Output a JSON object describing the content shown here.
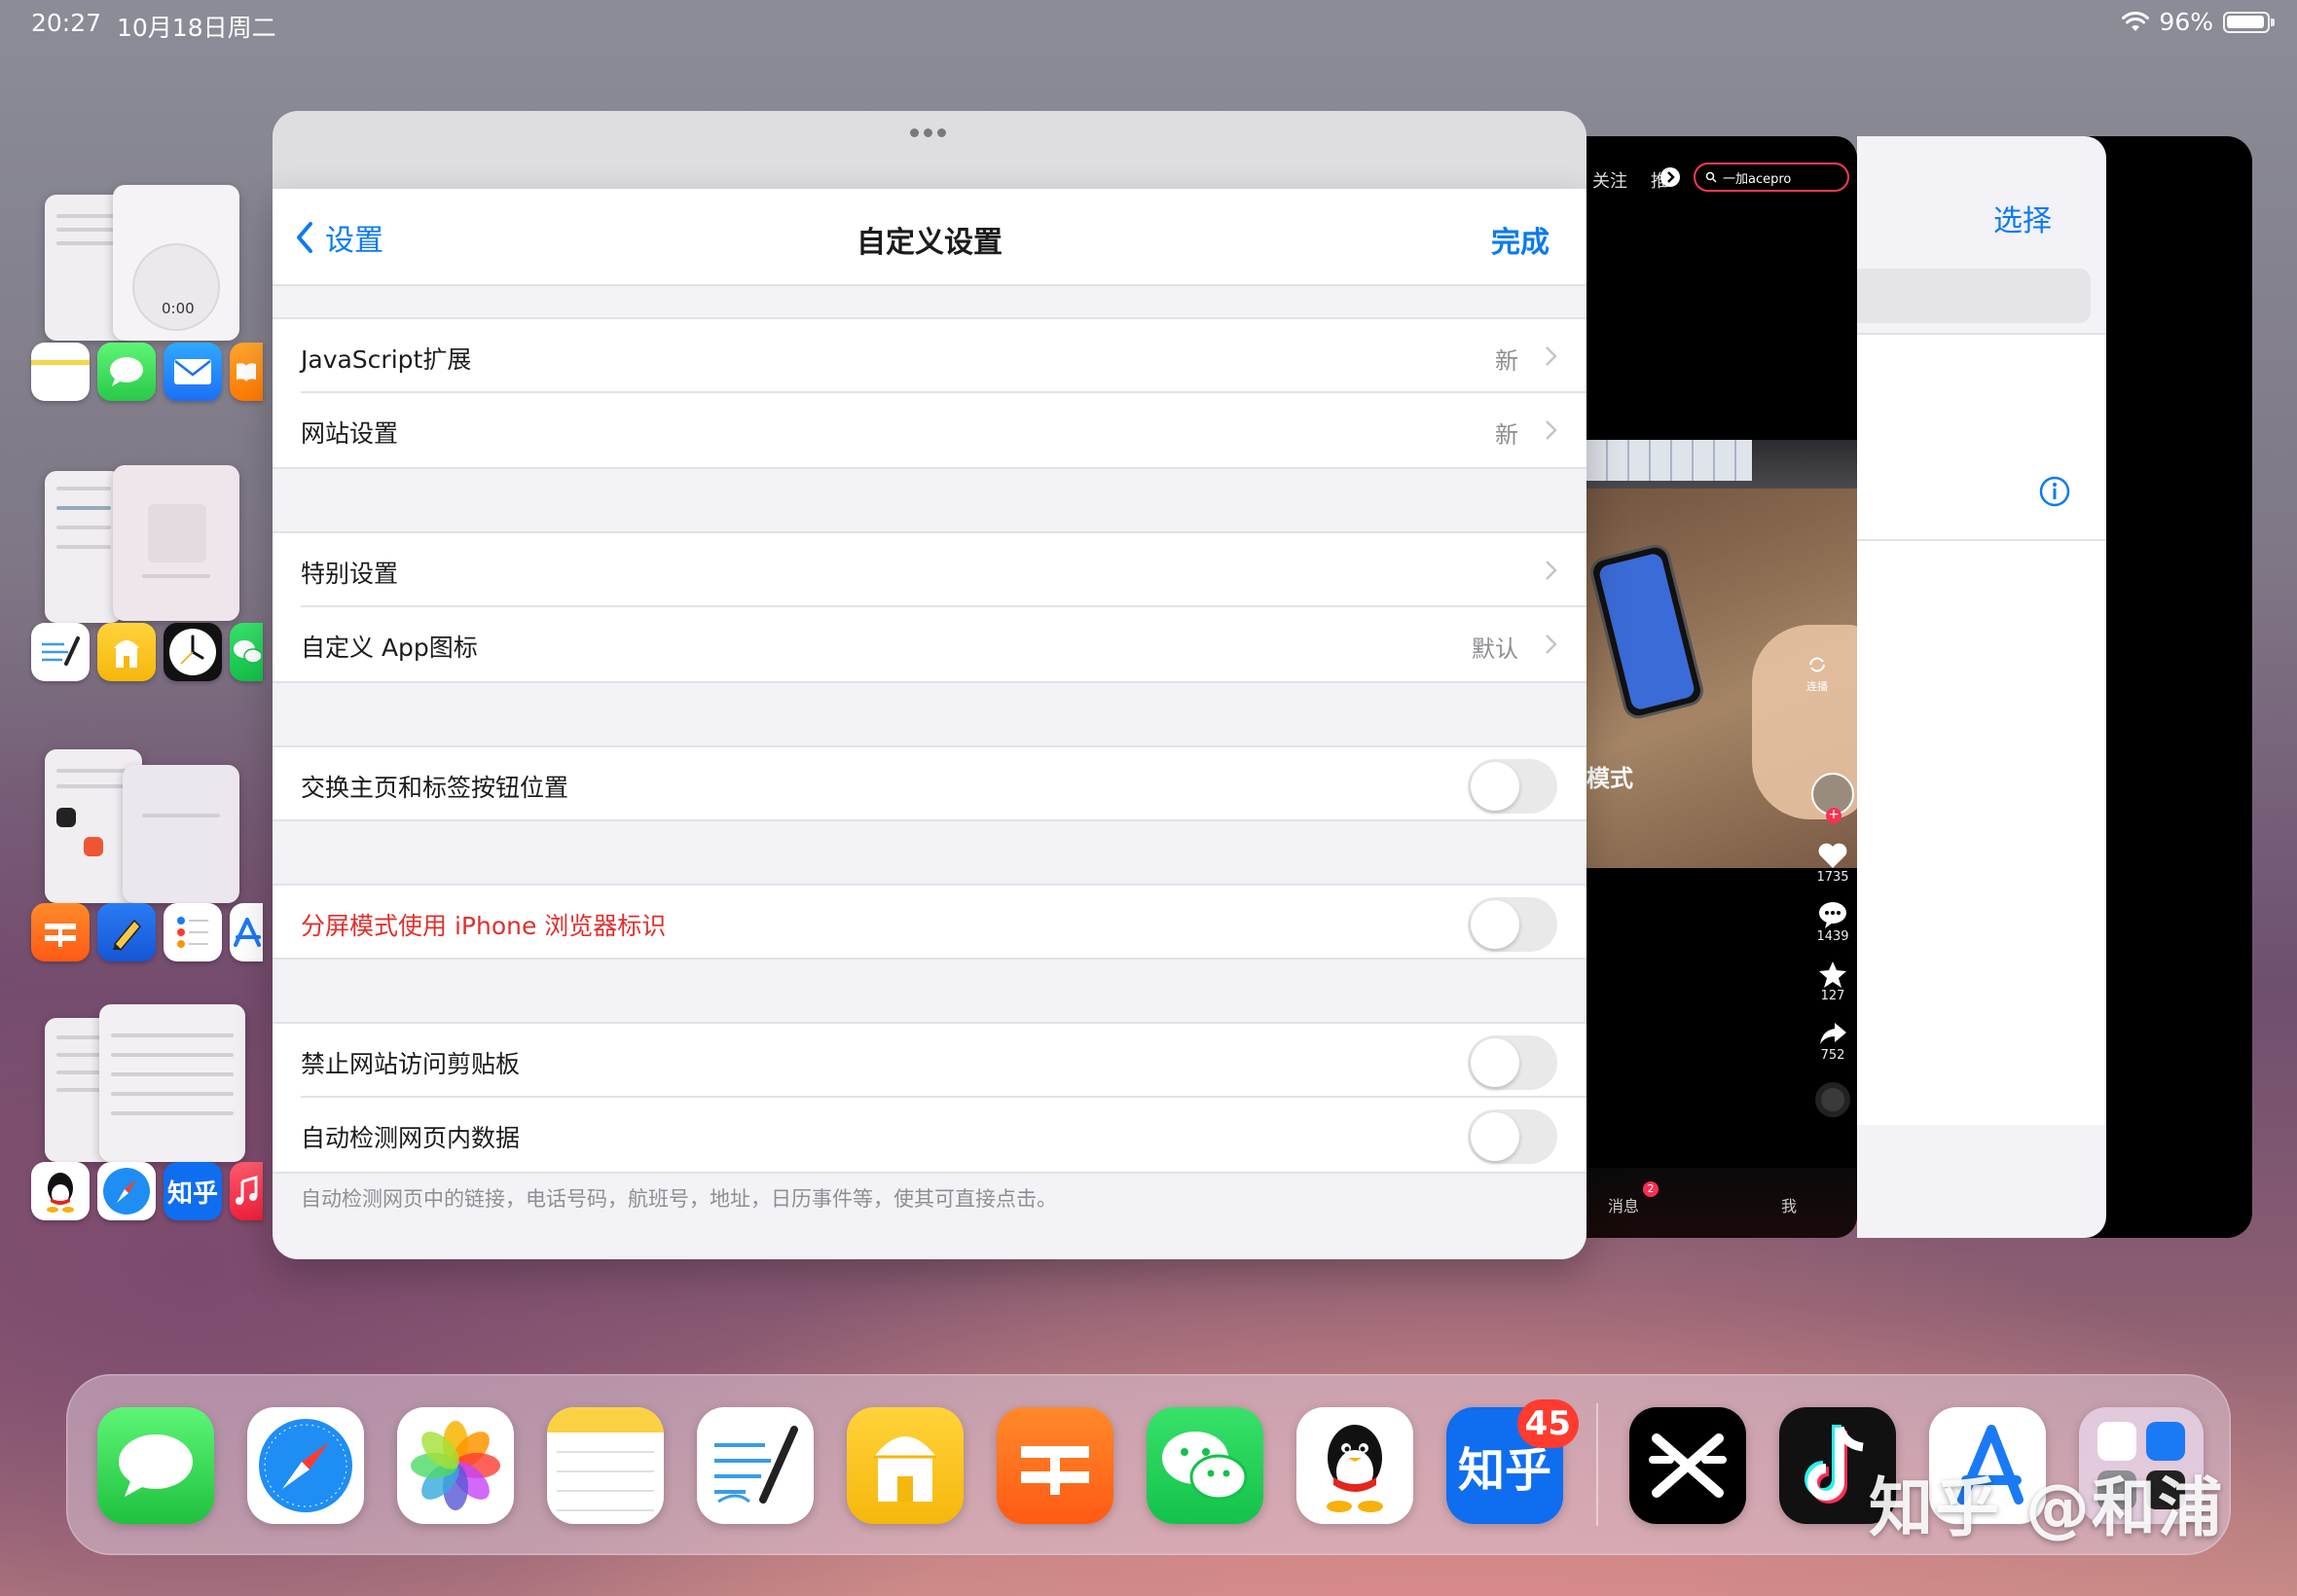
{
  "status_bar": {
    "time": "20:27",
    "date": "10月18日周二",
    "battery": "96%"
  },
  "left_groups": [
    {
      "thumb_label": "0:00",
      "icons": [
        "notes",
        "messages",
        "mail",
        "books"
      ]
    },
    {
      "icons": [
        "freeform",
        "memo",
        "clock",
        "wechat"
      ]
    },
    {
      "icons": [
        "pages",
        "pencil",
        "reminders",
        "appstore"
      ]
    },
    {
      "icons": [
        "qq",
        "safari",
        "zhihu",
        "music"
      ],
      "zhihu_label": "知乎"
    }
  ],
  "settings": {
    "back_label": "设置",
    "title": "自定义设置",
    "done_label": "完成",
    "rows": {
      "js": {
        "label": "JavaScript扩展",
        "value": "新"
      },
      "site": {
        "label": "网站设置",
        "value": "新"
      },
      "special": {
        "label": "特别设置"
      },
      "app_icon": {
        "label": "自定义 App图标",
        "value": "默认"
      },
      "swap": {
        "label": "交换主页和标签按钮位置",
        "on": false
      },
      "split": {
        "label": "分屏模式使用 iPhone 浏览器标识",
        "on": false
      },
      "clipboard": {
        "label": "禁止网站访问剪贴板",
        "on": false
      },
      "detect": {
        "label": "自动检测网页内数据",
        "on": false
      }
    },
    "footer": "自动检测网页中的链接，电话号码，航班号，地址，日历事件等，使其可直接点击。"
  },
  "douyin": {
    "tab_follow": "关注",
    "tab_partial": "推",
    "search_text": "一加acepro",
    "caption_fragment": "模式",
    "connect_label": "连播",
    "likes": "1735",
    "comments": "1439",
    "favorites": "127",
    "shares": "752",
    "nav_messages": "消息",
    "nav_messages_badge": "2",
    "nav_me": "我"
  },
  "right_card": {
    "select_label": "选择"
  },
  "dock": {
    "apps": [
      "messages",
      "safari",
      "photos",
      "notes",
      "freeform",
      "memo",
      "pages",
      "wechat",
      "qq",
      "zhihu",
      "capcut",
      "tiktok",
      "appstore",
      "app-library"
    ],
    "zhihu_label": "知乎",
    "zhihu_badge": "45"
  },
  "watermark": "知乎 @和浦",
  "colors": {
    "accent": "#0a7af5",
    "destructive": "#e0302d",
    "badge": "#ff3b30"
  }
}
